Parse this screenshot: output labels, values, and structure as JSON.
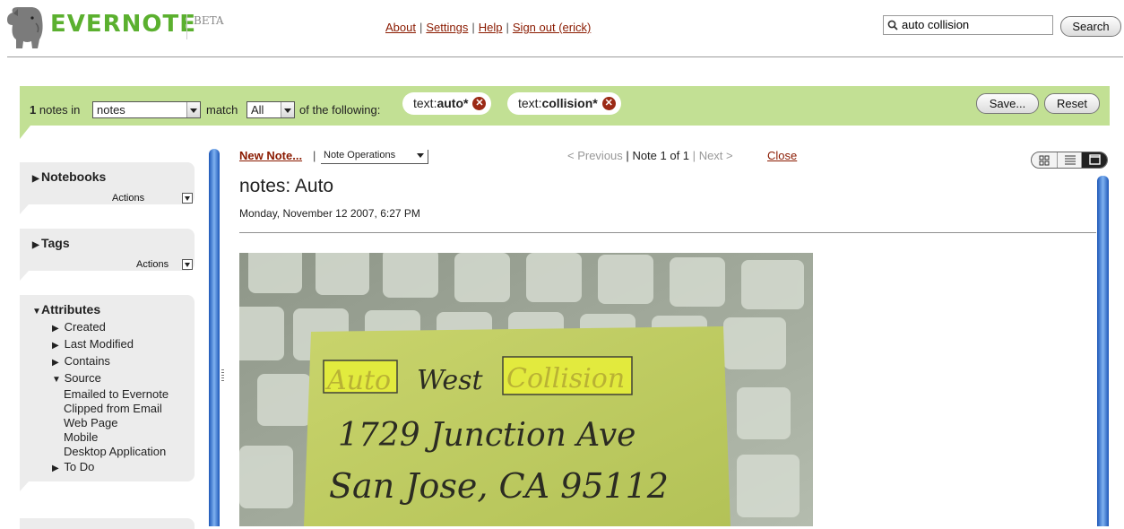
{
  "header": {
    "logo_text": "EVERNOTE",
    "beta_label": "BETA",
    "links": [
      "About",
      "Settings",
      "Help",
      "Sign out (erick)"
    ],
    "search_value": "auto collision",
    "search_button": "Search"
  },
  "filter": {
    "count": "1",
    "notes_in_label": "notes in",
    "notebook_value": "notes",
    "match_label": "match",
    "match_value": "All",
    "following_label": "of the following:",
    "chips": [
      {
        "prefix": "text:",
        "term": "auto*"
      },
      {
        "prefix": "text:",
        "term": "collision*"
      }
    ],
    "save_button": "Save...",
    "reset_button": "Reset"
  },
  "sidebar": {
    "notebooks": {
      "title": "Notebooks",
      "actions": "Actions"
    },
    "tags": {
      "title": "Tags",
      "actions": "Actions"
    },
    "attributes": {
      "title": "Attributes",
      "items": [
        "Created",
        "Last Modified",
        "Contains",
        "Source",
        "To Do"
      ],
      "source_children": [
        "Emailed to Evernote",
        "Clipped from Email",
        "Web Page",
        "Mobile",
        "Desktop Application"
      ]
    }
  },
  "note": {
    "new_note": "New Note...",
    "operations": "Note Operations",
    "pager_prev": "< Previous",
    "pager_current": "Note 1 of 1",
    "pager_next": "Next >",
    "close": "Close",
    "title": "notes: Auto",
    "date": "Monday, November 12 2007, 6:27 PM",
    "image_text": {
      "line1_a": "Auto",
      "line1_b": "West",
      "line1_c": "Collision",
      "line2": "1729 Junction Ave",
      "line3": "San Jose, CA 95112"
    }
  },
  "colors": {
    "brand_green": "#5bb02f",
    "filter_bar": "#c2e094",
    "link_red": "#8a1a00",
    "highlight": "#e6ee3a"
  }
}
